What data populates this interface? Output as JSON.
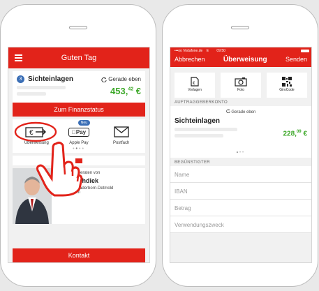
{
  "phone1": {
    "header": {
      "title": "Guten Tag"
    },
    "account": {
      "number_badge": "3",
      "name": "Sichteinlagen",
      "refresh_label": "Gerade eben",
      "balance_main": "453,",
      "balance_cents": "42",
      "currency": "€"
    },
    "finance_button": "Zum Finanzstatus",
    "payments": {
      "items": [
        {
          "label": "Überweisung"
        },
        {
          "label": "Apple Pay"
        },
        {
          "label": "Postfach"
        }
      ],
      "applepay_logo": "Pay",
      "new_badge": "Neu"
    },
    "advisor": {
      "intro": "Sie werden beraten von",
      "name": "Ralf Strohdiek",
      "org": "Sparkasse Paderborn-Detmold",
      "dept": "Privatkunden"
    },
    "contact_button": "Kontakt",
    "colors": {
      "brand": "#e2231a",
      "balance": "#3da829",
      "badge": "#3b6fb6"
    },
    "icons": [
      "menu-icon",
      "refresh-icon",
      "transfer-icon",
      "apple-pay-icon",
      "mail-icon",
      "hand-pointer-icon"
    ]
  },
  "phone2": {
    "status": {
      "carrier": "•••oo Vodafone.de",
      "network": "E",
      "time": "09:50"
    },
    "nav": {
      "cancel": "Abbrechen",
      "title": "Überweisung",
      "send": "Senden"
    },
    "tiles": [
      {
        "label": "Vorlagen",
        "icon": "template-icon"
      },
      {
        "label": "Foto",
        "icon": "camera-icon"
      },
      {
        "label": "GiroCode",
        "icon": "qr-code-icon"
      }
    ],
    "auftraggeber_label": "AUFTRAGGEBERKONTO",
    "auftraggeber": {
      "refresh_label": "Gerade eben",
      "name": "Sichteinlagen",
      "balance_main": "228,",
      "balance_cents": "09",
      "currency": "€"
    },
    "beguenstigter_label": "BEGÜNSTIGTER",
    "fields": [
      {
        "placeholder": "Name"
      },
      {
        "placeholder": "IBAN"
      },
      {
        "placeholder": "Betrag"
      },
      {
        "placeholder": "Verwendungszweck"
      }
    ]
  }
}
